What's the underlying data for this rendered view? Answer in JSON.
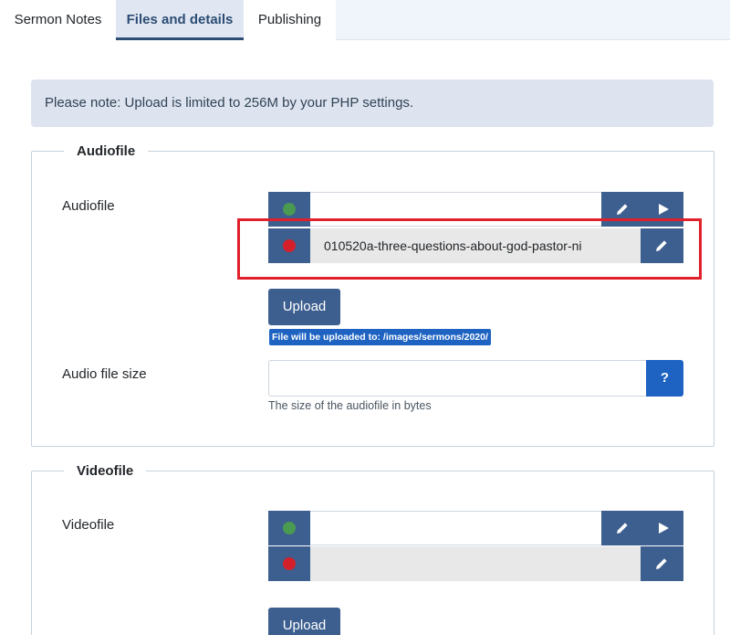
{
  "tabs": [
    {
      "label": "Sermon Notes"
    },
    {
      "label": "Files and details"
    },
    {
      "label": "Publishing"
    }
  ],
  "notice": "Please note: Upload is limited to 256M by your PHP settings.",
  "audio_section": {
    "legend": "Audiofile",
    "field_label": "Audiofile",
    "path_value": "",
    "file_value": "010520a-three-questions-about-god-pastor-ni",
    "upload_label": "Upload",
    "upload_note": "File will be uploaded to: /images/sermons/2020/",
    "size_label": "Audio file size",
    "size_value": "",
    "size_help": "?",
    "size_hint": "The size of the audiofile in bytes"
  },
  "video_section": {
    "legend": "Videofile",
    "field_label": "Videofile",
    "path_value": "",
    "file_value": "",
    "upload_label": "Upload"
  },
  "icons": {
    "status_ok": "green-dot-icon",
    "status_missing": "red-dot-icon",
    "edit": "pencil-icon",
    "play": "play-icon"
  },
  "colors": {
    "primary": "#3d5f8f",
    "accent": "#1e63c2",
    "highlight": "#e0202a"
  }
}
